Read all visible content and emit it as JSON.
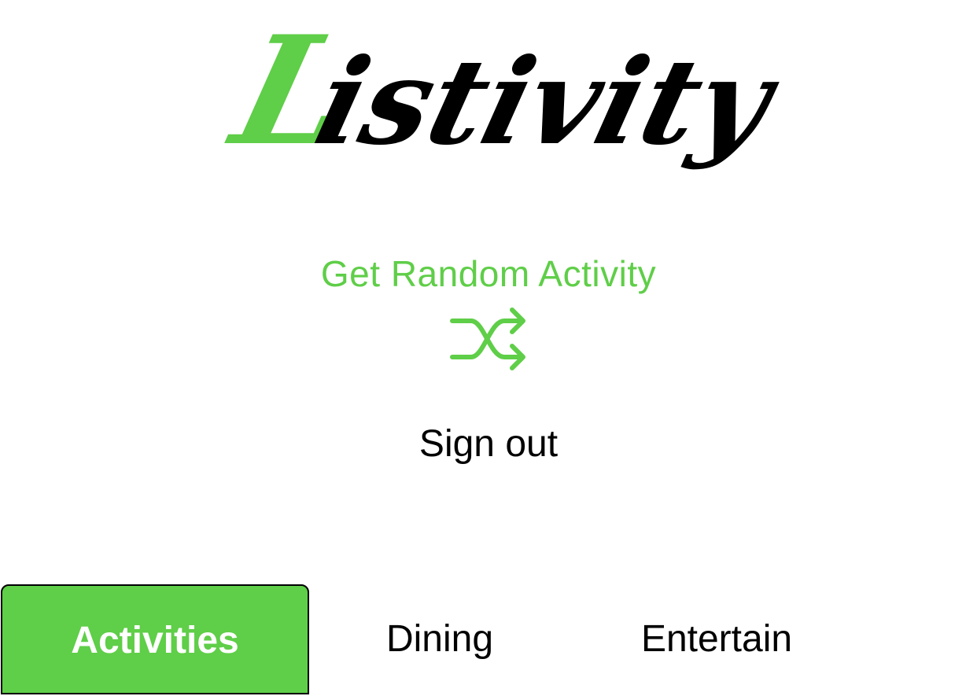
{
  "app": {
    "logo_text": "Listivity",
    "logo_first_letter": "L",
    "logo_rest": "istivity"
  },
  "actions": {
    "random_label": "Get Random Activity",
    "random_icon": "shuffle-icon",
    "signout_label": "Sign out"
  },
  "tabs": [
    {
      "label": "Activities",
      "selected": true
    },
    {
      "label": "Dining",
      "selected": false
    },
    {
      "label": "Entertain",
      "selected": false
    }
  ],
  "colors": {
    "accent": "#5fce48",
    "text": "#000000",
    "background": "#ffffff"
  }
}
